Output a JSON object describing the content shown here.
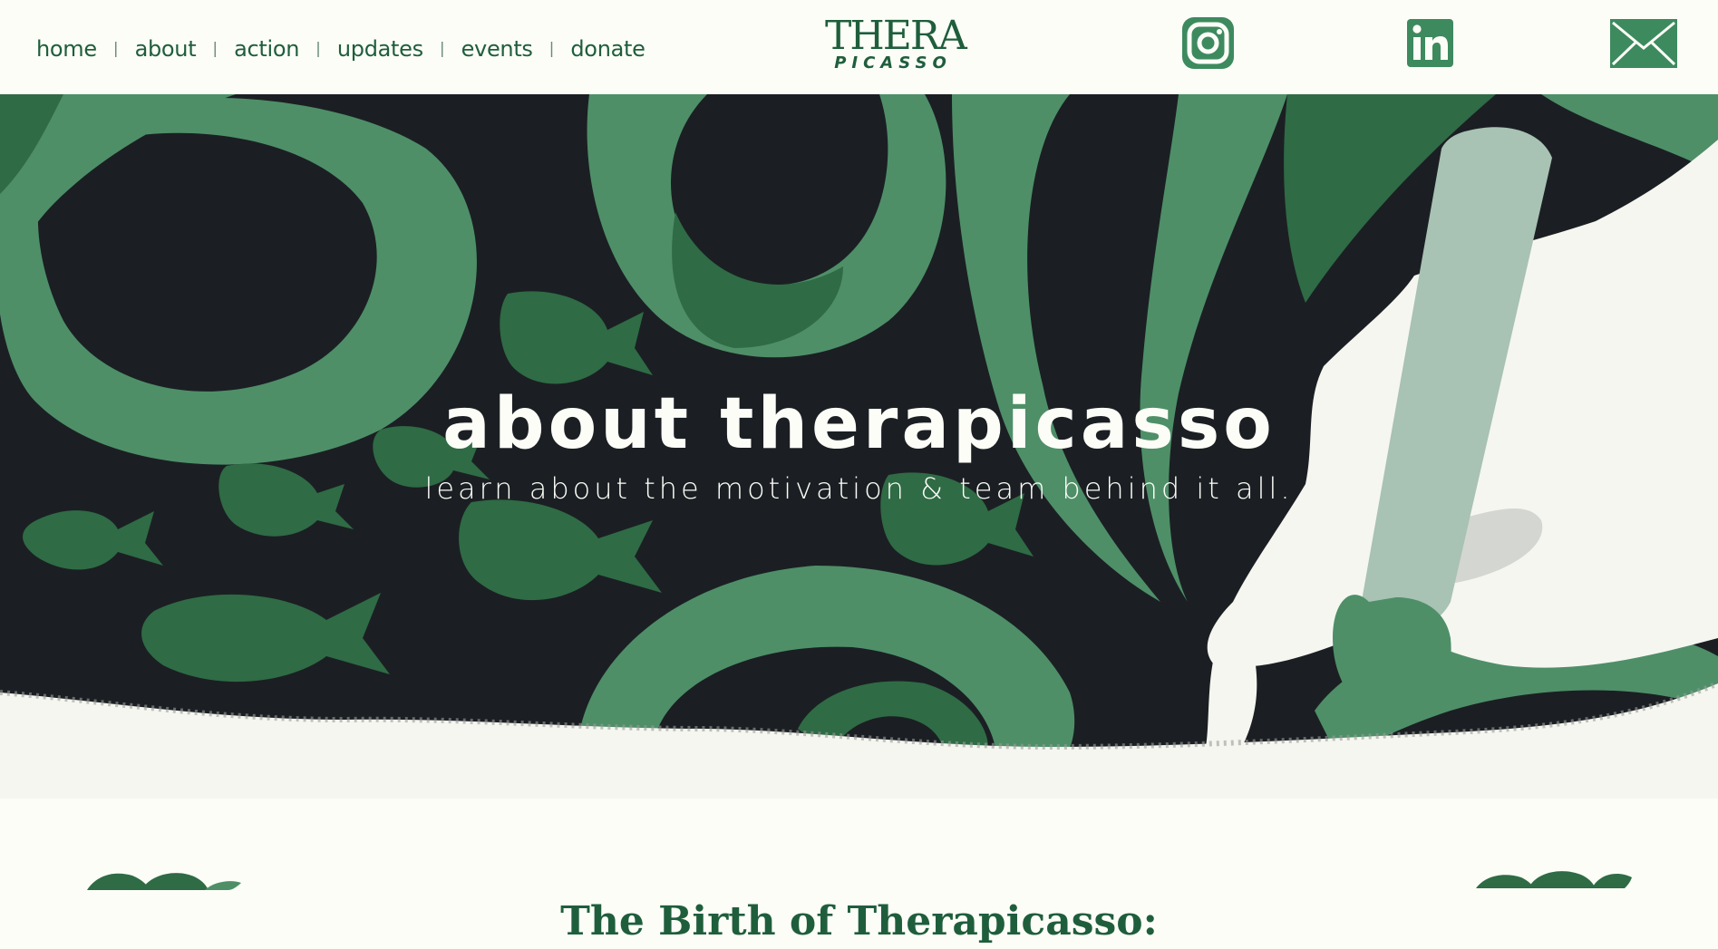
{
  "nav": {
    "items": [
      "home",
      "about",
      "action",
      "updates",
      "events",
      "donate"
    ],
    "separator": "|"
  },
  "logo": {
    "top": "THERA",
    "bottom": "PICASSO"
  },
  "social": {
    "instagram_icon": "instagram-icon",
    "linkedin_icon": "linkedin-icon",
    "email_icon": "envelope-icon"
  },
  "hero": {
    "title": "about therapicasso",
    "subtitle": "learn about the motivation & team behind it all."
  },
  "section": {
    "title": "The Birth of Therapicasso:"
  },
  "colors": {
    "background": "#fcfdf7",
    "brand_green": "#1f5e3c",
    "hero_dark": "#1b1f23",
    "leaf_green": "#4e8f68",
    "leaf_dark": "#2f6b45",
    "brush_pale": "#a8c2b3"
  }
}
